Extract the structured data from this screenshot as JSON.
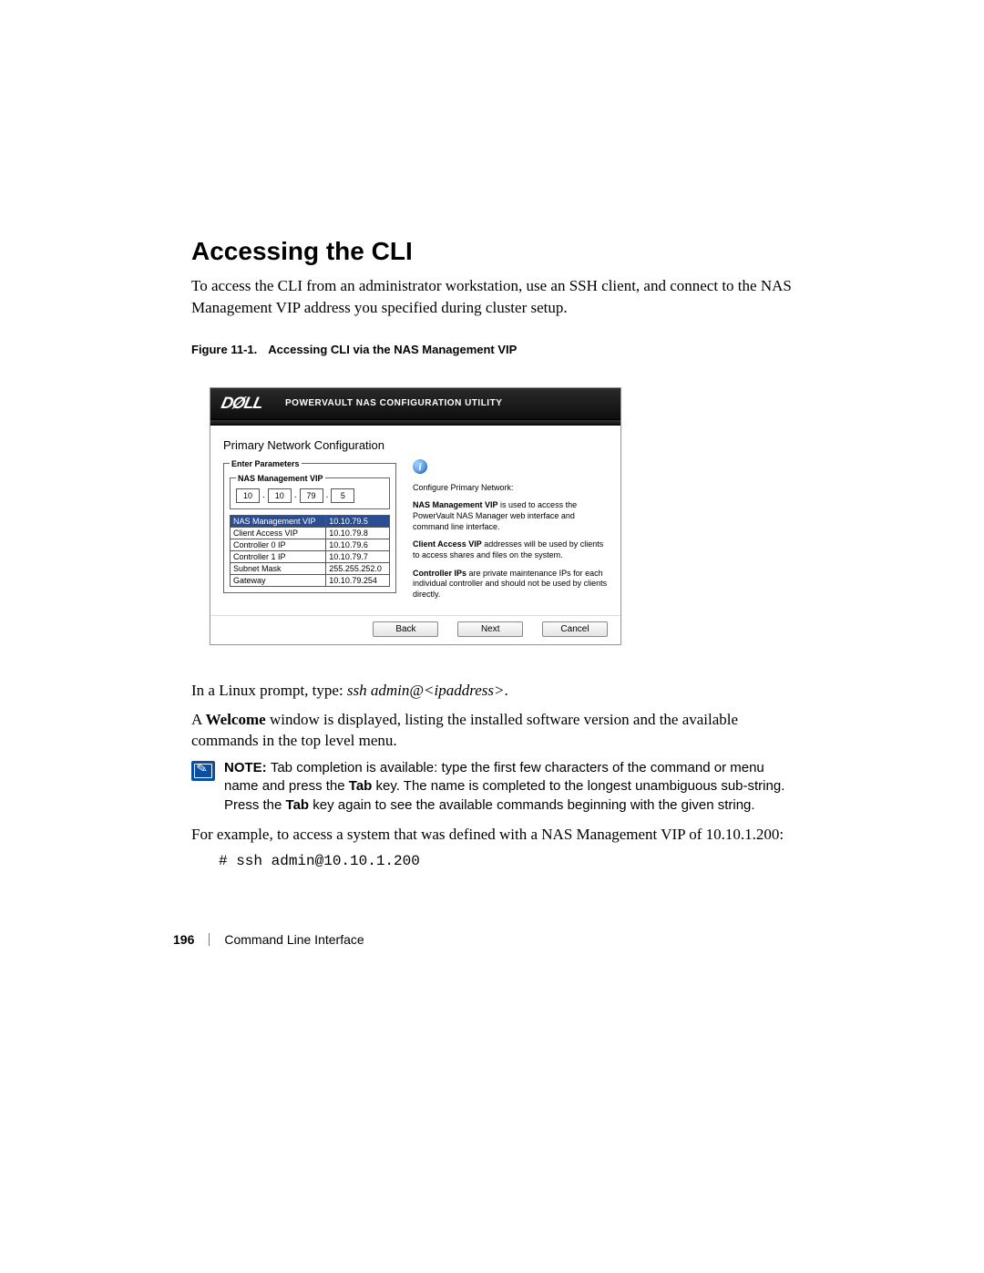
{
  "heading": "Accessing the CLI",
  "intro": "To access the CLI from an administrator workstation, use an SSH client, and connect to the NAS Management VIP address you specified during cluster setup.",
  "figure": {
    "label": "Figure 11-1.",
    "title": "Accessing CLI via the NAS Management VIP"
  },
  "screenshot": {
    "logo": "DØLL",
    "titlebar": "POWERVAULT NAS CONFIGURATION UTILITY",
    "section_title": "Primary Network Configuration",
    "enter_params_legend": "Enter Parameters",
    "vip_legend": "NAS Management VIP",
    "ip_octets": [
      "10",
      "10",
      "79",
      "5"
    ],
    "table": [
      {
        "label": "NAS Management VIP",
        "value": "10.10.79.5",
        "selected": true
      },
      {
        "label": "Client Access VIP",
        "value": "10.10.79.8",
        "selected": false
      },
      {
        "label": "Controller 0 IP",
        "value": "10.10.79.6",
        "selected": false
      },
      {
        "label": "Controller 1 IP",
        "value": "10.10.79.7",
        "selected": false
      },
      {
        "label": "Subnet Mask",
        "value": "255.255.252.0",
        "selected": false
      },
      {
        "label": "Gateway",
        "value": "10.10.79.254",
        "selected": false
      }
    ],
    "info_glyph": "i",
    "info": {
      "p1": "Configure Primary Network:",
      "p2_b": "NAS Management VIP",
      "p2": " is used to access the PowerVault NAS Manager web interface and command line interface.",
      "p3_b": "Client Access VIP",
      "p3": " addresses will be used by clients to access shares and files on the system.",
      "p4_b": "Controller IPs",
      "p4": " are private maintenance IPs for each individual controller and should not be used by clients directly."
    },
    "buttons": {
      "back": "Back",
      "next": "Next",
      "cancel": "Cancel"
    }
  },
  "after_fig": {
    "p1_a": "In a Linux prompt, type: ",
    "p1_i": "ssh admin@<ipaddress>",
    "p1_c": ".",
    "p2_a": "A ",
    "p2_b": "Welcome",
    "p2_c": " window is displayed, listing the installed software version and the available commands in the top level menu."
  },
  "note": {
    "bold_lead": "NOTE: ",
    "t1": "Tab completion is available: type the first few characters of the command or menu name and press the ",
    "k1": "Tab",
    "t2": " key. The name is completed to the longest unambiguous sub-string. Press the ",
    "k2": "Tab",
    "t3": " key again to see the available commands beginning with the given string."
  },
  "example_intro": "For example, to access a system that was defined with a NAS Management VIP of 10.10.1.200:",
  "example_cmd": "# ssh admin@10.10.1.200",
  "footer": {
    "page": "196",
    "section": "Command Line Interface"
  }
}
